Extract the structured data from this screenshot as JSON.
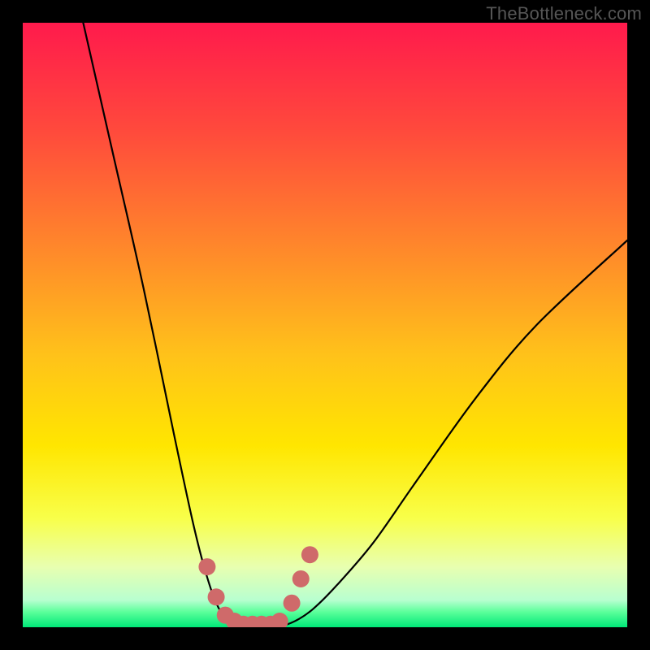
{
  "watermark": "TheBottleneck.com",
  "chart_data": {
    "type": "line",
    "title": "",
    "xlabel": "",
    "ylabel": "",
    "xlim": [
      0,
      100
    ],
    "ylim": [
      0,
      100
    ],
    "grid": false,
    "legend": false,
    "series": [
      {
        "name": "bottleneck-curve",
        "x": [
          10,
          15,
          20,
          25,
          28,
          30,
          32,
          34,
          36,
          38,
          40,
          42,
          45,
          48,
          52,
          58,
          65,
          75,
          85,
          100
        ],
        "y": [
          100,
          78,
          56,
          32,
          18,
          10,
          4,
          1,
          0,
          0,
          0,
          0,
          1,
          3,
          7,
          14,
          24,
          38,
          50,
          64
        ],
        "color": "#000000"
      }
    ],
    "markers": {
      "name": "sweet-spot-points",
      "color": "#cf6a6a",
      "x": [
        30.5,
        32.0,
        33.5,
        35.0,
        36.5,
        38.0,
        39.5,
        41.0,
        42.5,
        44.5,
        46.0,
        47.5
      ],
      "y": [
        10,
        5,
        2,
        1,
        0.5,
        0.5,
        0.5,
        0.5,
        1,
        4,
        8,
        12
      ]
    },
    "gradient_stops": [
      {
        "pos": 0.0,
        "color": "#ff1a4c"
      },
      {
        "pos": 0.18,
        "color": "#ff4a3c"
      },
      {
        "pos": 0.38,
        "color": "#ff8a2a"
      },
      {
        "pos": 0.55,
        "color": "#ffc21a"
      },
      {
        "pos": 0.7,
        "color": "#ffe600"
      },
      {
        "pos": 0.82,
        "color": "#f8ff4a"
      },
      {
        "pos": 0.9,
        "color": "#e8ffb0"
      },
      {
        "pos": 0.955,
        "color": "#b8ffd0"
      },
      {
        "pos": 0.975,
        "color": "#5aff9a"
      },
      {
        "pos": 1.0,
        "color": "#00e878"
      }
    ]
  }
}
